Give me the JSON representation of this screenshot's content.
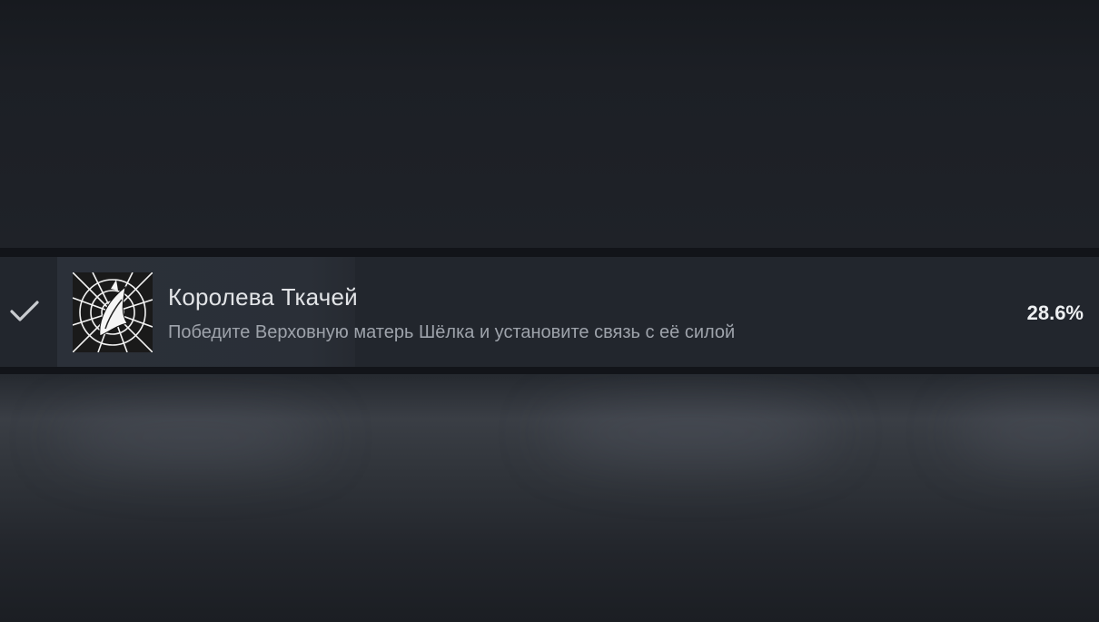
{
  "achievement": {
    "unlocked": true,
    "check_icon": "checkmark-icon",
    "badge_icon": "silk-weaver-badge-icon",
    "title": "Королева Ткачей",
    "description": "Победите Верховную матерь Шёлка и установите связь с её силой",
    "percent": "28.6%"
  },
  "colors": {
    "background": "#1c1f25",
    "row": "#22262d",
    "title": "#e2e4e7",
    "description": "#9ea3ab"
  }
}
